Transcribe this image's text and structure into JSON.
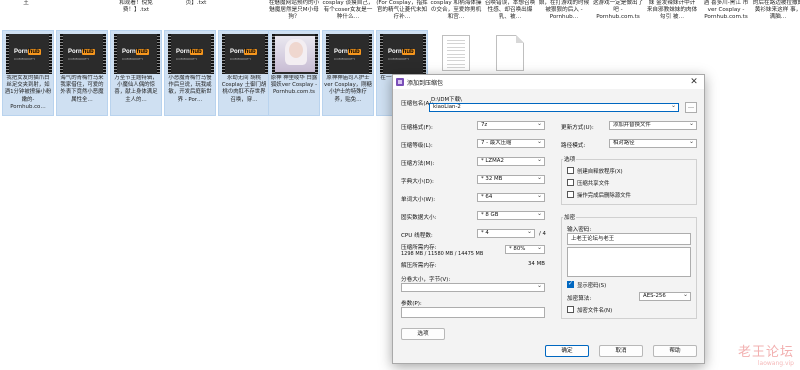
{
  "explorer": {
    "top_captions": [
      {
        "text": "王",
        "left": 0
      },
      {
        "text": "",
        "left": 0
      },
      {
        "text": "和观看！倪免费！】.txt",
        "left": 0
      },
      {
        "text": "页】.txt",
        "left": 0
      },
      {
        "text": "在魅魔网站预约的小魅魔居然是只M小母狗？",
        "left": 0
      },
      {
        "text": "cosplay 谈摸自己，有个coser女友是一种什么…",
        "left": 0
      },
      {
        "text": "(For Cosplay，指挥官的精气让菱代未知疗补…",
        "left": 0
      },
      {
        "text": "cosplay 和柄海体操の交合，至爱妳男机和宫…",
        "left": 0
      },
      {
        "text": "召唤错误，本想召唤性感、却召唤出爆乳、被…",
        "left": 0
      },
      {
        "text": "娘，在打游戏的时候被狠狠的后入 - Pornhub…",
        "left": 0
      },
      {
        "text": "这游戏一定是做出了吧 - Pornhub.com.ts",
        "left": 0
      },
      {
        "text": "妹 金发辣妹计中计 来自邪教妹妹的肉体勾引 被…",
        "left": 0
      },
      {
        "text": "酒 喜多川-黑江 市ver Cosplay - Pornhub.com.ts",
        "left": 0
      },
      {
        "text": "的后在路边被拉撒的黄衫妹来这样 事，满脑…",
        "left": 0
      }
    ],
    "tiles": [
      {
        "kind": "video",
        "caption": "我把女友的猫爪白丝足交夹到射，如酒1分钟被撩操小粉嫩的- Pornhub.co…",
        "selected": true
      },
      {
        "kind": "video",
        "caption": "海气的青梅竹马来我家借住，可爱的外表下竟然小恶魔属性全…",
        "selected": true
      },
      {
        "kind": "video",
        "caption": "万圣节主题特辑，小魔仙人偶的惊喜，献上身体满足主人的…",
        "selected": true
      },
      {
        "kind": "video",
        "caption": "小恶魔青梅竹马慢作后旦说，玩我咸敏，开发后庭新世界 - Por…",
        "selected": true
      },
      {
        "kind": "video",
        "caption": "永劫无间 胡桃 Cosplay 土御门胡桃の肉肛不存世界召唤，穿…",
        "selected": true
      },
      {
        "kind": "photo",
        "caption": "原神 神里绫华 白露狐妖ver Cosplay - Pornhub.com.ts",
        "selected": true
      },
      {
        "kind": "video",
        "caption": "原神神庙司人护士ver Cosplay，刚糖小护士的特殊疗养，贴免…",
        "selected": true
      },
      {
        "kind": "video",
        "caption": "在一个让她抛弃…",
        "selected": true
      },
      {
        "kind": "doc",
        "caption": "",
        "selected": false
      },
      {
        "kind": "blank",
        "caption": "",
        "selected": false
      }
    ]
  },
  "dialog": {
    "title": "添加到压缩包",
    "close_glyph": "✕",
    "archive_name_label": "压缩包名(A):",
    "archive_path": "D:\\IDM下载\\",
    "archive_name": "kiaoLian-2",
    "browse_label": "…",
    "left": {
      "format_label": "压缩格式(F):",
      "format_value": "7z",
      "level_label": "压缩等级(L):",
      "level_value": "7 - 最大压缩",
      "method_label": "压缩方法(M):",
      "method_value": "* LZMA2",
      "dict_label": "字典大小(D):",
      "dict_value": "* 32 MB",
      "word_label": "单词大小(W):",
      "word_value": "* 64",
      "solid_label": "固实数据大小:",
      "solid_value": "* 8 GB",
      "cpu_label": "CPU 线程数:",
      "cpu_value": "* 4",
      "cpu_total": "/ 4",
      "memory_label": "压缩所需内存:",
      "memory_detail": "1298 MB / 11580 MB / 14475 MB",
      "memory_percent": "* 80%",
      "decomp_label": "解压所需内存:",
      "decomp_value": "34 MB",
      "split_label": "分卷大小，字节(V):",
      "split_value": "",
      "params_label": "参数(P):",
      "params_value": "",
      "options_button": "选项"
    },
    "right": {
      "update_label": "更新方式(U):",
      "update_value": "添加并替换文件",
      "pathmode_label": "路径模式:",
      "pathmode_value": "相对路径",
      "options_group": "选项",
      "opt_sfx": "创建自释放程序(X)",
      "opt_shared": "压缩共享文件",
      "opt_delete": "操作完成后删除源文件",
      "encrypt_group": "加密",
      "password_label": "输入密码:",
      "password_value": "上老王论坛与老王",
      "show_password": "显示密码(S)",
      "enc_method_label": "加密算法:",
      "enc_method_value": "AES-256",
      "encrypt_names": "加密文件名(N)"
    },
    "checkboxes": {
      "sfx": false,
      "shared": false,
      "delete": false,
      "show_password": true,
      "encrypt_names": false
    },
    "buttons": {
      "ok": "确定",
      "cancel": "取消",
      "help": "帮助"
    }
  },
  "watermark": {
    "title": "老王论坛",
    "url": "laowang.vip"
  },
  "logo": {
    "porn": "Porn",
    "hub": "hub",
    "sub": "COMMUNITY"
  }
}
